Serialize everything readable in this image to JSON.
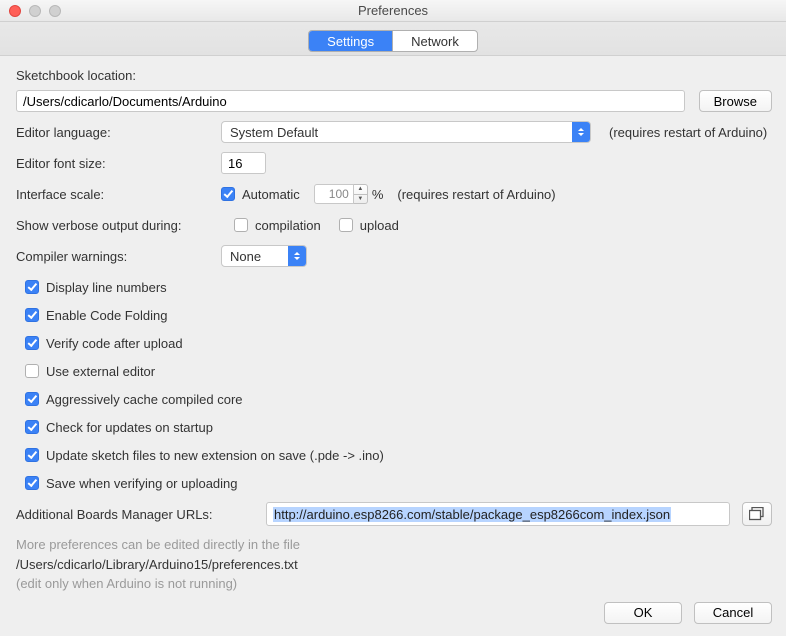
{
  "window": {
    "title": "Preferences"
  },
  "tabs": {
    "settings": "Settings",
    "network": "Network"
  },
  "sketchbook": {
    "label": "Sketchbook location:",
    "path": "/Users/cdicarlo/Documents/Arduino",
    "browse": "Browse"
  },
  "editorLanguage": {
    "label": "Editor language:",
    "value": "System Default",
    "hint": "(requires restart of Arduino)"
  },
  "fontSize": {
    "label": "Editor font size:",
    "value": "16"
  },
  "interfaceScale": {
    "label": "Interface scale:",
    "auto": "Automatic",
    "value": "100",
    "pct": "%",
    "hint": "(requires restart of Arduino)"
  },
  "verbose": {
    "label": "Show verbose output during:",
    "compilation": "compilation",
    "upload": "upload"
  },
  "compilerWarnings": {
    "label": "Compiler warnings:",
    "value": "None"
  },
  "checks": {
    "lineNumbers": "Display line numbers",
    "codeFolding": "Enable Code Folding",
    "verifyAfterUpload": "Verify code after upload",
    "externalEditor": "Use external editor",
    "cacheCore": "Aggressively cache compiled core",
    "checkUpdates": "Check for updates on startup",
    "updateExt": "Update sketch files to new extension on save (.pde -> .ino)",
    "saveVerify": "Save when verifying or uploading"
  },
  "boardsUrl": {
    "label": "Additional Boards Manager URLs:",
    "value": "http://arduino.esp8266.com/stable/package_esp8266com_index.json"
  },
  "moreprefs": {
    "line1": "More preferences can be edited directly in the file",
    "path": "/Users/cdicarlo/Library/Arduino15/preferences.txt",
    "line2": "(edit only when Arduino is not running)"
  },
  "buttons": {
    "ok": "OK",
    "cancel": "Cancel"
  }
}
